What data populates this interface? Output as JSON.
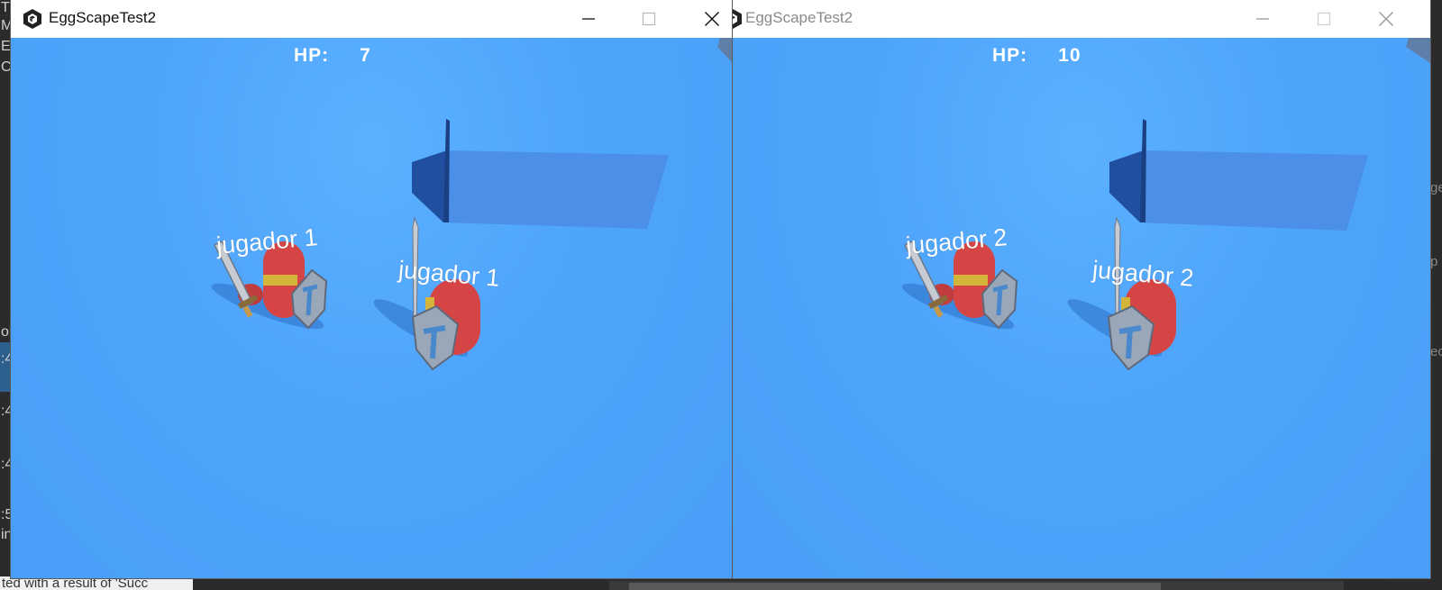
{
  "background": {
    "left_fragments": [
      "T",
      "M",
      "E",
      "C",
      "oll",
      ":4",
      ":4",
      ":4",
      ":5",
      "in"
    ],
    "status_text": "ted with a result of 'Succ",
    "right_fragments": [
      "ge",
      "p",
      "ec"
    ]
  },
  "windows": [
    {
      "title": "EggScapeTest2",
      "active": true,
      "hud": {
        "label": "HP:",
        "value": "7"
      },
      "labels": [
        "jugador 1",
        "jugador 1"
      ]
    },
    {
      "title": "EggScapeTest2",
      "active": false,
      "hud": {
        "label": "HP:",
        "value": "10"
      },
      "labels": [
        "jugador 2",
        "jugador 2"
      ]
    }
  ],
  "icons": {
    "app": "unity-logo-icon",
    "minimize": "minimize-icon",
    "maximize": "maximize-icon",
    "close": "close-icon"
  },
  "colors": {
    "sky": "#4aa0fa",
    "platform_top": "#4b8fe8",
    "platform_side": "#1f4f9e",
    "player_body": "#d64545",
    "visor": "#d4b43a",
    "shield": "#9aa7b8",
    "shield_emblem": "#4a88cc"
  }
}
